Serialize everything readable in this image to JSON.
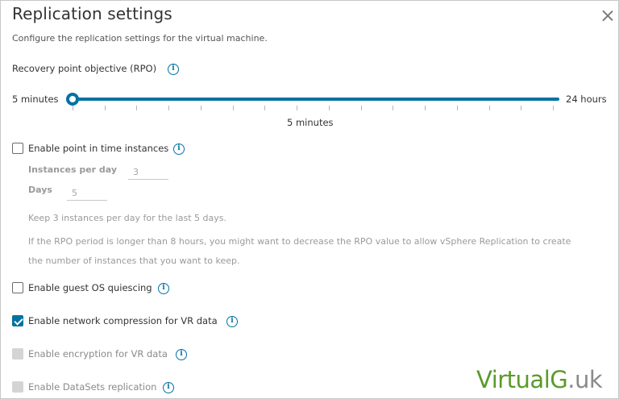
{
  "dialog": {
    "title": "Replication settings",
    "subtitle": "Configure the replication settings for the virtual machine."
  },
  "rpo": {
    "label": "Recovery point objective (RPO)",
    "min_label": "5 minutes",
    "max_label": "24 hours",
    "current_value": "5 minutes",
    "position_fraction": 0.0
  },
  "options": {
    "point_in_time": {
      "label": "Enable point in time instances",
      "checked": false
    },
    "instances_per_day": {
      "label": "Instances per day",
      "value": "3"
    },
    "days": {
      "label": "Days",
      "value": "5"
    },
    "keep_note": "Keep 3 instances per day for the last 5 days.",
    "rpo_note_line1": "If the RPO period is longer than 8 hours, you might want to decrease the RPO value to allow vSphere Replication to create",
    "rpo_note_line2": "the number of instances that you want to keep.",
    "guest_os": {
      "label": "Enable guest OS quiescing",
      "checked": false
    },
    "network_compression": {
      "label": "Enable network compression for VR data",
      "checked": true
    },
    "encryption": {
      "label": "Enable encryption for VR data",
      "checked": false,
      "disabled": true
    },
    "datasets": {
      "label": "Enable DataSets replication",
      "checked": false,
      "disabled": true
    }
  },
  "watermark": {
    "part1": "VirtualG",
    "part2": ".uk"
  },
  "colors": {
    "accent": "#0072a3",
    "watermark_green": "#5a9a2a",
    "watermark_gray": "#8a8a8a"
  }
}
